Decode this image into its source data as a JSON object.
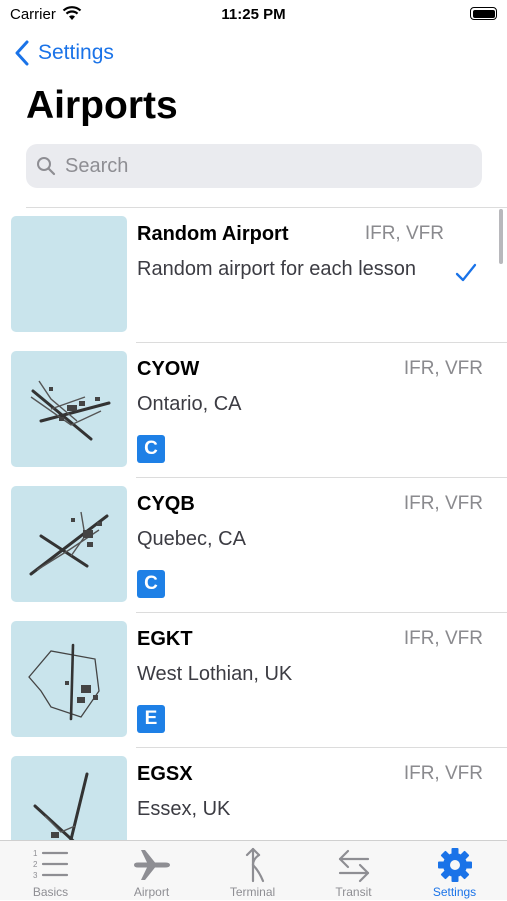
{
  "status": {
    "carrier": "Carrier",
    "time": "11:25 PM"
  },
  "nav": {
    "back_label": "Settings"
  },
  "page": {
    "title": "Airports"
  },
  "search": {
    "placeholder": "Search"
  },
  "airports": [
    {
      "code": "Random Airport",
      "rules": "IFR, VFR",
      "place": "Random airport for each lesson",
      "selected": true
    },
    {
      "code": "CYOW",
      "rules": "IFR, VFR",
      "place": "Ontario, CA",
      "badge": "C"
    },
    {
      "code": "CYQB",
      "rules": "IFR, VFR",
      "place": "Quebec, CA",
      "badge": "C"
    },
    {
      "code": "EGKT",
      "rules": "IFR, VFR",
      "place": "West Lothian, UK",
      "badge": "E"
    },
    {
      "code": "EGSX",
      "rules": "IFR, VFR",
      "place": "Essex, UK"
    }
  ],
  "tabs": [
    {
      "label": "Basics",
      "icon": "numbered-list-icon"
    },
    {
      "label": "Airport",
      "icon": "airplane-icon"
    },
    {
      "label": "Terminal",
      "icon": "route-arrow-icon"
    },
    {
      "label": "Transit",
      "icon": "transfer-arrows-icon"
    },
    {
      "label": "Settings",
      "icon": "gear-icon",
      "active": true
    }
  ],
  "colors": {
    "accent": "#1a73e8",
    "badge": "#1e80e6",
    "thumb_water": "#c9e4ec"
  }
}
